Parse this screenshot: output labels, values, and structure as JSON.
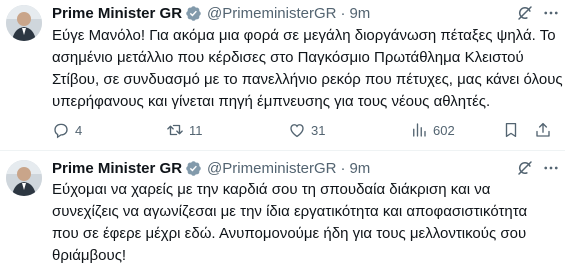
{
  "tweets": [
    {
      "author_name": "Prime Minister GR",
      "handle": "@PrimeministerGR",
      "separator": "·",
      "time": "9m",
      "lines": [
        "Εύγε Μανόλο! Για ακόμα μια φορά σε μεγάλη διοργάνωση πέταξες ψηλά. Το",
        "ασημένιο μετάλλιο που κέρδισες στο Παγκόσμιο Πρωτάθλημα Κλειστού",
        "Στίβου, σε συνδυασμό με το πανελλήνιο ρεκόρ που πέτυχες, μας κάνει όλους",
        "υπερήφανους και γίνεται πηγή έμπνευσης για τους νέους αθλητές."
      ],
      "replies": "4",
      "reposts": "11",
      "likes": "31",
      "views": "602"
    },
    {
      "author_name": "Prime Minister GR",
      "handle": "@PrimeministerGR",
      "separator": "·",
      "time": "9m",
      "lines": [
        "Εύχομαι να χαρείς με την καρδιά σου τη σπουδαία διάκριση και να",
        "συνεχίζεις να αγωνίζεσαι με την ίδια εργατικότητα και αποφασιστικότητα",
        "που σε έφερε μέχρι εδώ. Ανυπομονούμε ήδη για τους μελλοντικούς σου",
        "θριάμβους!"
      ]
    }
  ],
  "colors": {
    "text": "#0f1419",
    "secondary": "#536471",
    "verified": "#829aab",
    "divider": "#eff3f4"
  },
  "icons": [
    "avatar",
    "verified-badge-icon",
    "grok-icon",
    "more-icon",
    "reply-icon",
    "repost-icon",
    "like-icon",
    "views-icon",
    "bookmark-icon",
    "share-icon"
  ]
}
